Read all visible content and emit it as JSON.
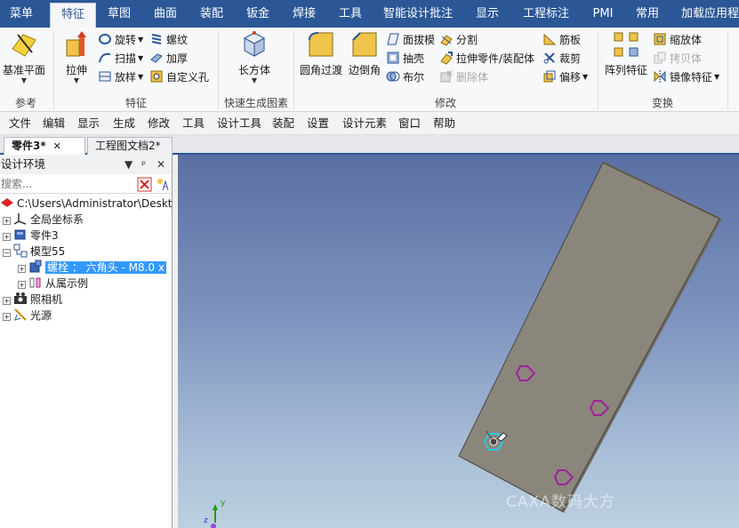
{
  "ribbon_tabs": [
    "菜单",
    "特征",
    "草图",
    "曲面",
    "装配",
    "钣金",
    "焊接",
    "工具",
    "智能设计批注",
    "显示",
    "工程标注",
    "PMI",
    "常用",
    "加载应用程"
  ],
  "active_tab": "特征",
  "ribbon": {
    "ref_plane": "基准平面",
    "extrude": "拉伸",
    "revolve": "旋转",
    "sweep": "扫描",
    "loft": "放样",
    "thread": "螺纹",
    "thicken": "加厚",
    "custom_hole": "自定义孔",
    "box": "长方体",
    "fillet": "圆角过渡",
    "chamfer": "边倒角",
    "draft": "面拔模",
    "shell": "抽壳",
    "boolean": "布尔",
    "split": "分割",
    "stretch": "拉伸零件/装配体",
    "delete_body": "删除体",
    "rib": "筋板",
    "trim": "裁剪",
    "offset": "偏移",
    "pattern": "阵列特征",
    "scale": "缩放体",
    "copy": "拷贝体",
    "mirror": "镜像特征",
    "group_ref": "参考",
    "group_feature": "特征",
    "group_quick": "快速生成图素",
    "group_modify": "修改",
    "group_transform": "变换"
  },
  "menu": [
    "文件",
    "编辑",
    "显示",
    "生成",
    "修改",
    "工具",
    "设计工具",
    "装配",
    "设置",
    "设计元素",
    "窗口",
    "帮助"
  ],
  "doc_tabs": [
    {
      "label": "零件3*",
      "active": true
    },
    {
      "label": "工程图文档2*",
      "active": false
    }
  ],
  "panel": {
    "title": "设计环境",
    "search_placeholder": "搜索...",
    "tree": [
      {
        "label": "C:\\Users\\Administrator\\Deskt"
      },
      {
        "label": "全局坐标系"
      },
      {
        "label": "零件3"
      },
      {
        "label": "模型55"
      },
      {
        "label": "螺栓 ： 六角头 - M8.0 x"
      },
      {
        "label": "从属示例"
      },
      {
        "label": "照相机"
      },
      {
        "label": "光源"
      }
    ]
  },
  "viewport": {
    "watermark": "CAXA数码大方"
  },
  "colors": {
    "ribbon_tab_bg": "#2b5797",
    "plate_fill": "#8b867b",
    "hole_outline": "#a0209f",
    "selected_hole": "#29c7e8",
    "selection": "#3399ff"
  }
}
